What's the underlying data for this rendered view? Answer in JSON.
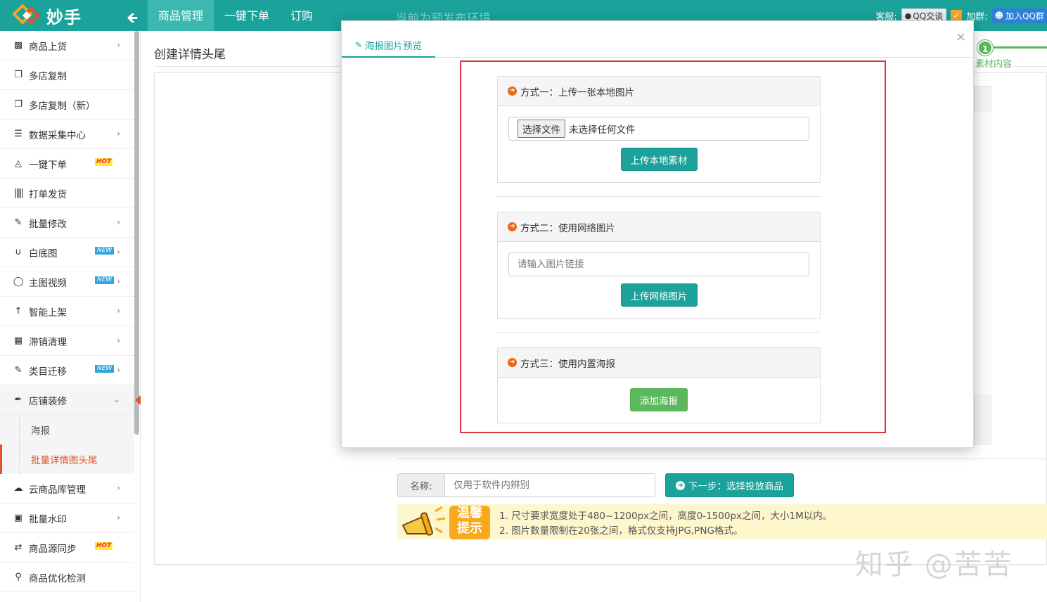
{
  "topbar": {
    "logo_text": "妙手",
    "nav": [
      {
        "label": "商品管理",
        "active": true
      },
      {
        "label": "一键下单",
        "active": false
      },
      {
        "label": "订购",
        "active": false
      }
    ],
    "env_notice": "当前为预发布环境",
    "service_label": "客服:",
    "qq_chat": "QQ交谈",
    "group_label": "加群:",
    "join_group": "加入QQ群"
  },
  "sidebar": {
    "items": [
      {
        "label": "商品上货",
        "icon": "box-icon",
        "chevron": true
      },
      {
        "label": "多店复制",
        "icon": "copy-icon",
        "chevron": false
      },
      {
        "label": "多店复制（新）",
        "icon": "copy-icon",
        "chevron": false
      },
      {
        "label": "数据采集中心",
        "icon": "database-icon",
        "chevron": true
      },
      {
        "label": "一键下单",
        "icon": "cart-icon",
        "chevron": false,
        "badge": "HOT"
      },
      {
        "label": "打单发货",
        "icon": "barcode-icon",
        "chevron": false
      },
      {
        "label": "批量修改",
        "icon": "edit-icon",
        "chevron": true
      },
      {
        "label": "白底图",
        "icon": "magnet-icon",
        "chevron": true,
        "badge": "NEW"
      },
      {
        "label": "主图视频",
        "icon": "play-icon",
        "chevron": true,
        "badge": "NEW"
      },
      {
        "label": "智能上架",
        "icon": "upload-arrow-icon",
        "chevron": true
      },
      {
        "label": "滞销清理",
        "icon": "table-icon",
        "chevron": true
      },
      {
        "label": "类目迁移",
        "icon": "edit-icon",
        "chevron": true,
        "badge": "NEW"
      },
      {
        "label": "店铺装修",
        "icon": "brush-icon",
        "chevron": true,
        "open": true
      }
    ],
    "subitems": [
      {
        "label": "海报",
        "active": false
      },
      {
        "label": "批量详情图头尾",
        "active": true
      }
    ],
    "items_after": [
      {
        "label": "云商品库管理",
        "icon": "cloud-icon",
        "chevron": true
      },
      {
        "label": "批量水印",
        "icon": "image-icon",
        "chevron": true
      },
      {
        "label": "商品源同步",
        "icon": "sync-icon",
        "chevron": false,
        "badge": "HOT"
      },
      {
        "label": "商品优化检测",
        "icon": "search-icon",
        "chevron": false
      }
    ]
  },
  "main": {
    "page_title": "创建详情头尾",
    "step_number": "1",
    "step_label": "素材内容",
    "name_label": "名称:",
    "name_placeholder": "仅用于软件内辨别",
    "next_button": "下一步：选择投放商品",
    "tips_badge_line1": "温馨",
    "tips_badge_line2": "提示",
    "tips": [
      "1. 尺寸要求宽度处于480~1200px之间，高度0-1500px之间，大小1M以内。",
      "2. 图片数量限制在20张之间，格式仅支持JPG,PNG格式。"
    ],
    "watermark": "知乎 @苦苦"
  },
  "modal": {
    "tab_label": "海报图片预览",
    "close": "×",
    "method1": {
      "title": "方式一：上传一张本地图片",
      "file_button": "选择文件",
      "file_status": "未选择任何文件",
      "upload_button": "上传本地素材"
    },
    "method2": {
      "title": "方式二：使用网络图片",
      "url_placeholder": "请输入图片链接",
      "upload_button": "上传网络图片"
    },
    "method3": {
      "title": "方式三：使用内置海报",
      "add_button": "添加海报"
    }
  },
  "colors": {
    "primary": "#1aa29b",
    "success": "#5cb85c",
    "danger_outline": "#d9353b",
    "active_menu": "#e5532b",
    "tips_bg": "#fef6cd"
  }
}
